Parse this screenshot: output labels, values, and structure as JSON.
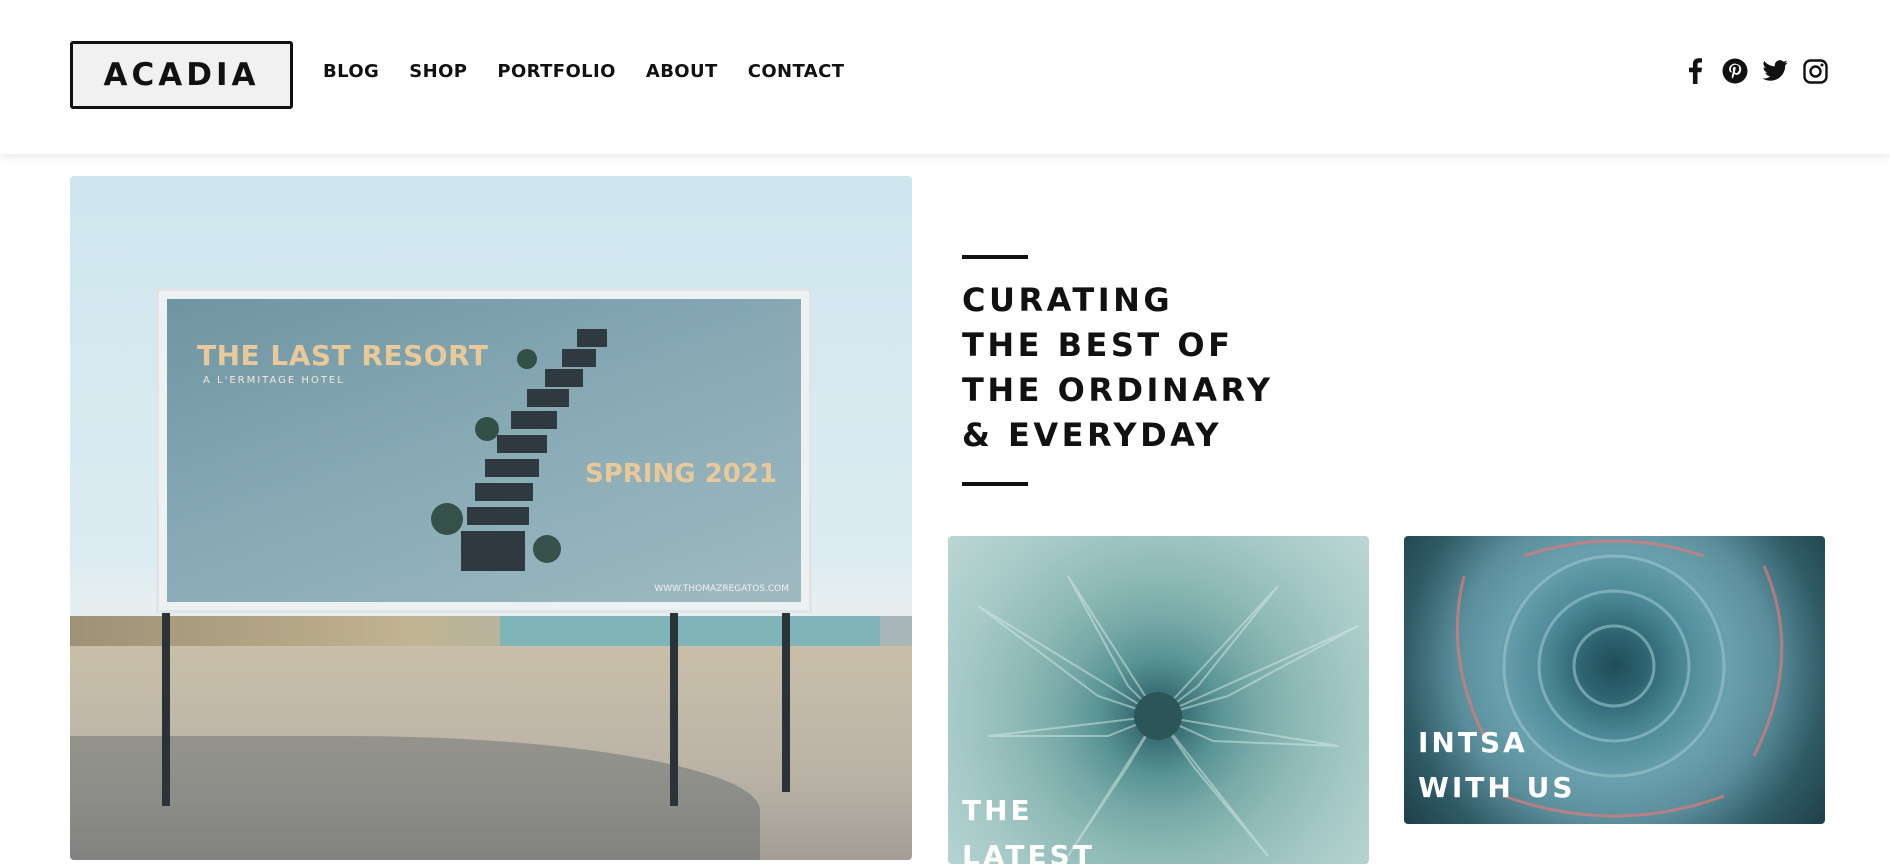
{
  "header": {
    "logo": "ACADIA",
    "nav": [
      "BLOG",
      "SHOP",
      "PORTFOLIO",
      "ABOUT",
      "CONTACT"
    ],
    "social": [
      "facebook-icon",
      "pinterest-icon",
      "twitter-icon",
      "instagram-icon"
    ]
  },
  "hero": {
    "billboard_title": "THE LAST RESORT",
    "billboard_subtitle": "A L'ERMITAGE HOTEL",
    "billboard_season": "SPRING 2021",
    "billboard_url": "WWW.THOMAZREGATOS.COM"
  },
  "intro": {
    "lines": [
      "CURATING",
      "THE BEST OF",
      "THE ORDINARY",
      "& EVERYDAY"
    ]
  },
  "cards": [
    {
      "title_lines": [
        "THE",
        "LATEST"
      ]
    },
    {
      "title_lines": [
        "INTSA",
        "WITH US"
      ]
    }
  ],
  "colors": {
    "text": "#111111",
    "background": "#ffffff",
    "card_text": "#ffffff"
  }
}
